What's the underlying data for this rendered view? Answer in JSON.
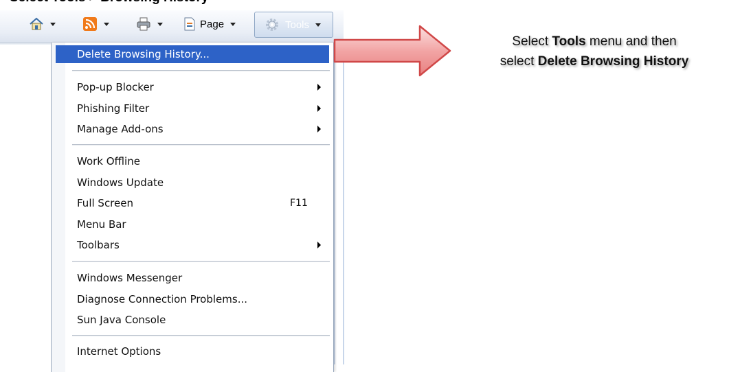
{
  "heading": {
    "text": "Select Tools > Browsing History"
  },
  "toolbar": {
    "home_icon": "home-icon",
    "feeds_icon": "rss-feed-icon",
    "print_icon": "printer-icon",
    "page_icon": "page-icon",
    "page_label": "Page",
    "tools_icon": "gear-icon",
    "tools_label": "Tools"
  },
  "menu": {
    "items": [
      {
        "label": "Delete Browsing History...",
        "highlighted": true
      },
      {
        "label": "Pop-up Blocker",
        "submenu": true
      },
      {
        "label": "Phishing Filter",
        "submenu": true
      },
      {
        "label": "Manage Add-ons",
        "submenu": true
      },
      {
        "label": "Work Offline"
      },
      {
        "label": "Windows Update"
      },
      {
        "label": "Full Screen",
        "shortcut": "F11"
      },
      {
        "label": "Menu Bar"
      },
      {
        "label": "Toolbars",
        "submenu": true
      },
      {
        "label": "Windows Messenger"
      },
      {
        "label": "Diagnose Connection Problems..."
      },
      {
        "label": "Sun Java Console"
      },
      {
        "label": "Internet Options"
      }
    ]
  },
  "callout": {
    "line1_pre": "Select ",
    "line1_bold": "Tools",
    "line1_post": " menu and then",
    "line2_pre": "select ",
    "line2_bold": "Delete Browsing History"
  },
  "colors": {
    "highlight": "#2d62c7",
    "arrow_fill": "#f2a5a5",
    "arrow_stroke": "#d04848"
  }
}
